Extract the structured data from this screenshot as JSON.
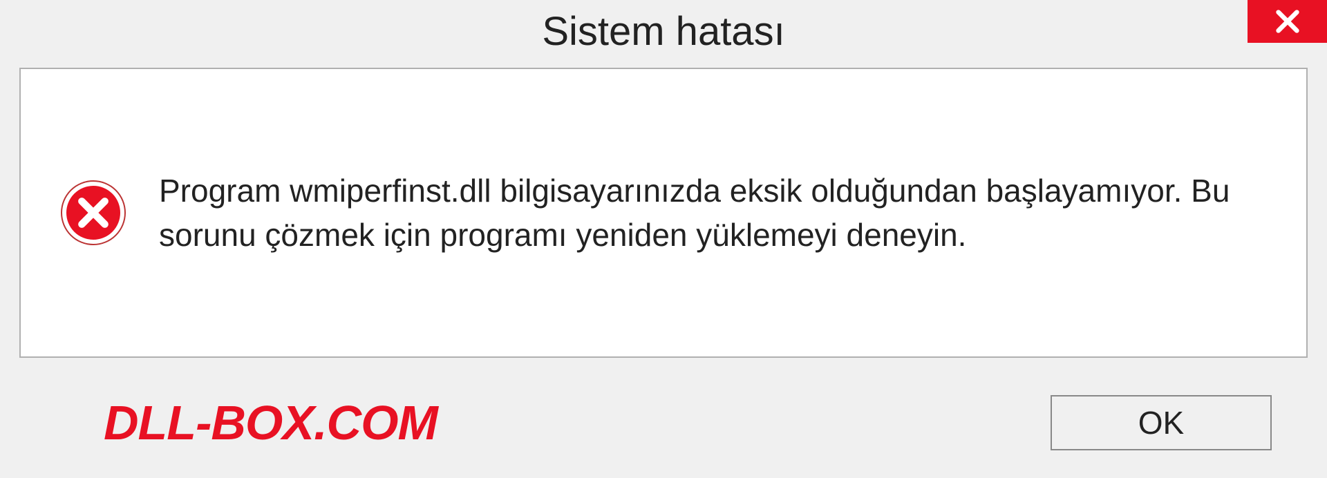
{
  "dialog": {
    "title": "Sistem hatası",
    "message": "Program wmiperfinst.dll bilgisayarınızda eksik olduğundan başlayamıyor. Bu sorunu çözmek için programı yeniden yüklemeyi deneyin.",
    "ok_label": "OK",
    "brand": "DLL-BOX.COM"
  }
}
